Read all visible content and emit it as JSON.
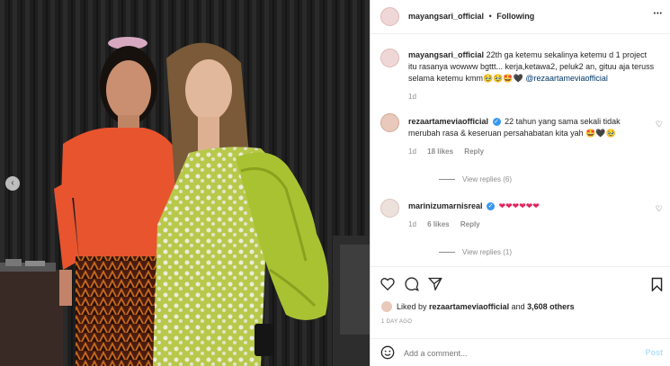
{
  "header": {
    "username": "mayangsari_official",
    "dot": "•",
    "follow_state": "Following",
    "more": "•••"
  },
  "caption": {
    "username": "mayangsari_official",
    "text": "22th ga ketemu sekalinya ketemu d 1 project itu rasanya wowww bgttt... kerja,ketawa2, peluk2 an, gituu aja teruss selama ketemu kmm🥹🥹🤩🖤",
    "mention": "@rezaartameviaofficial",
    "time": "1d"
  },
  "comments": [
    {
      "username": "rezaartameviaofficial",
      "text": "22 tahun yang sama sekali tidak merubah rasa & keseruan persahabatan kita yah 🤩🖤🥹",
      "time": "1d",
      "likes": "18 likes",
      "reply": "Reply",
      "view_replies": "View replies (6)"
    },
    {
      "username": "marinizumarnisreal",
      "text": "❤❤❤❤❤❤",
      "time": "1d",
      "likes": "6 likes",
      "reply": "Reply",
      "view_replies": "View replies (1)"
    }
  ],
  "likes": {
    "prefix": "Liked by",
    "user": "rezaartameviaofficial",
    "and": "and",
    "count": "3,608 others"
  },
  "timestamp": "1 DAY AGO",
  "add_comment": {
    "placeholder": "Add a comment...",
    "post": "Post"
  },
  "colors": {
    "accent": "#3897f0",
    "post_disabled": "#b2dffc"
  }
}
